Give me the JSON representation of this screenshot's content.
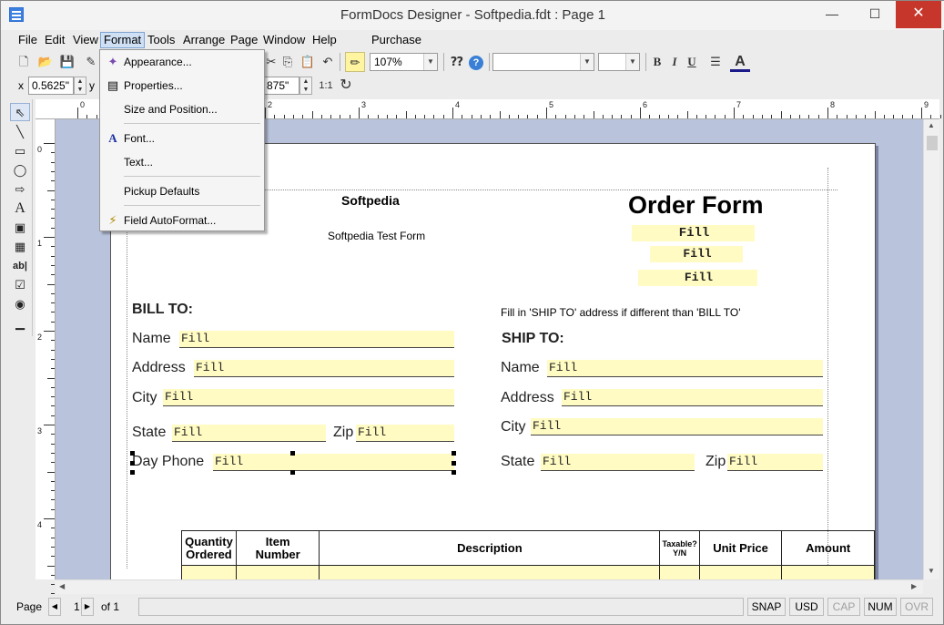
{
  "window": {
    "title": "FormDocs Designer - Softpedia.fdt : Page 1",
    "minimize": "—",
    "maximize": "☐",
    "close": "✕"
  },
  "menu": [
    "File",
    "Edit",
    "View",
    "Format",
    "Tools",
    "Arrange",
    "Page",
    "Window",
    "Help",
    "Purchase"
  ],
  "toolbar": {
    "zoom": "107%",
    "font_name": "",
    "font_size": "",
    "bold": "B",
    "italic": "I",
    "underline": "U",
    "font_color_glyph": "A"
  },
  "position": {
    "x_label": "x",
    "x_value": "0.5625\"",
    "y_label": "y",
    "h_value": "875\"",
    "ratio": "1:1"
  },
  "format_menu": {
    "items": [
      {
        "label": "Appearance...",
        "icon": "appearance-icon"
      },
      {
        "label": "Properties...",
        "icon": "properties-icon"
      },
      {
        "label": "Size and Position...",
        "icon": ""
      },
      {
        "label": "Font...",
        "icon": "font-icon"
      },
      {
        "label": "Text...",
        "icon": ""
      },
      {
        "label": "Pickup Defaults",
        "icon": ""
      },
      {
        "label": "Field AutoFormat...",
        "icon": "autoformat-icon"
      }
    ]
  },
  "ruler": {
    "h_numbers": [
      "0",
      "1",
      "2",
      "3",
      "4",
      "5",
      "6",
      "7",
      "8",
      "9"
    ],
    "v_numbers": [
      "0",
      "1",
      "2",
      "3",
      "4"
    ]
  },
  "form": {
    "company": "Softpedia",
    "subtitle": "Softpedia Test Form",
    "heading": "Order Form",
    "fill": "Fill",
    "bill_to": "BILL TO:",
    "ship_to": "SHIP TO:",
    "ship_note": "Fill in 'SHIP TO' address if different than 'BILL TO'",
    "bill_fields": {
      "name": "Name",
      "address": "Address",
      "city": "City",
      "state": "State",
      "zip": "Zip",
      "day_phone": "Day Phone"
    },
    "ship_fields": {
      "name": "Name",
      "address": "Address",
      "city": "City",
      "state": "State",
      "zip": "Zip"
    },
    "table_headers": {
      "qty": "Quantity Ordered",
      "item": "Item Number",
      "desc": "Description",
      "taxable": "Taxable? Y/N",
      "unit_price": "Unit Price",
      "amount": "Amount"
    }
  },
  "status": {
    "page_label": "Page",
    "page_number": "1",
    "of_label": "of 1",
    "snap": "SNAP",
    "usd": "USD",
    "cap": "CAP",
    "num": "NUM",
    "ovr": "OVR"
  }
}
